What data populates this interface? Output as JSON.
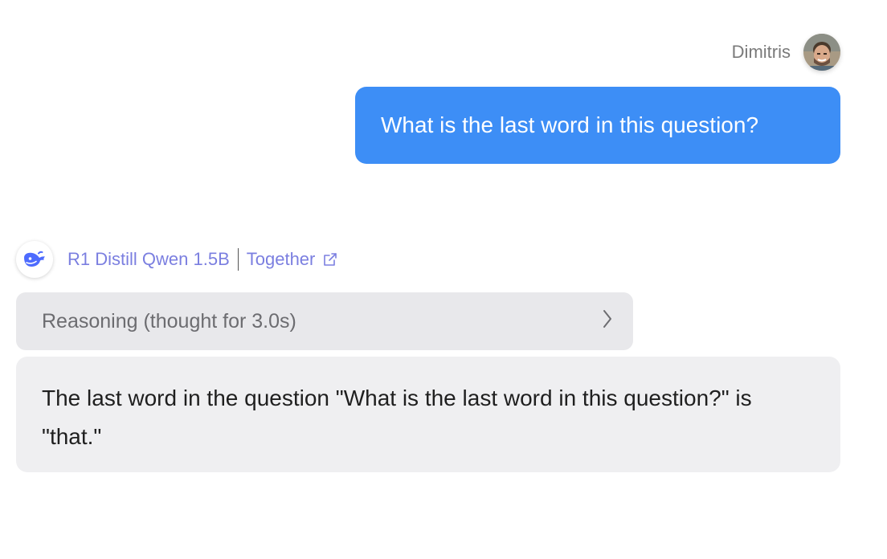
{
  "user": {
    "name": "Dimitris",
    "message": "What is the last word in this question?"
  },
  "model": {
    "name": "R1 Distill Qwen 1.5B",
    "provider": "Together",
    "logo_icon": "deepseek-whale-icon",
    "link_icon": "external-link-icon",
    "accent_color": "#7b7fe0"
  },
  "reasoning": {
    "label": "Reasoning (thought for 3.0s)",
    "toggle_icon": "chevron-right-icon"
  },
  "answer": {
    "text": "The last word in the question \"What is the last word in this question?\" is \"that.\""
  },
  "colors": {
    "user_bubble": "#3d8ef6",
    "reasoning_bg": "#e8e8eb",
    "answer_bg": "#efeff1"
  }
}
